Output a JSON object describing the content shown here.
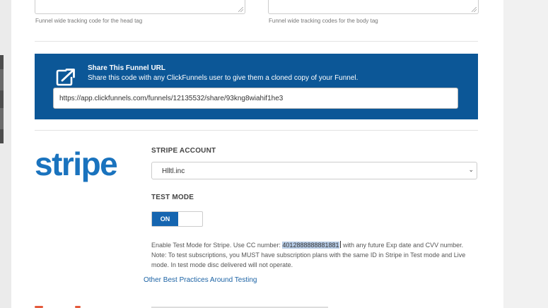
{
  "tracking": {
    "head_hint": "Funnel wide tracking code for the head tag",
    "body_hint": "Funnel wide tracking codes for the body tag"
  },
  "share": {
    "title": "Share This Funnel URL",
    "subtitle": "Share this code with any ClickFunnels user to give them a cloned copy of your Funnel.",
    "url": "https://app.clickfunnels.com/funnels/12135532/share/93kng8wiahif1he3",
    "icon": "external-link-icon"
  },
  "stripe": {
    "logo_text": "stripe",
    "brand_color": "#1a73be",
    "account_label": "STRIPE ACCOUNT",
    "account_value": "Hlltl.inc",
    "test_mode_label": "TEST MODE",
    "toggle_on_label": "ON",
    "note_prefix": "Enable Test Mode for Stripe. Use CC number: ",
    "cc_number": "4012888888881881",
    "note_suffix": " with any future Exp date and CVV number.",
    "note_line2": "Note: To test subscriptions, you MUST have subscription plans with the same ID in Stripe in Test mode and Live mode. In test mode disc delivered will not operate.",
    "best_practices_link": "Other Best Practices Around Testing"
  },
  "colors": {
    "share_bg": "#0c5797",
    "toggle_on": "#1565b0",
    "link": "#1c63a5"
  }
}
